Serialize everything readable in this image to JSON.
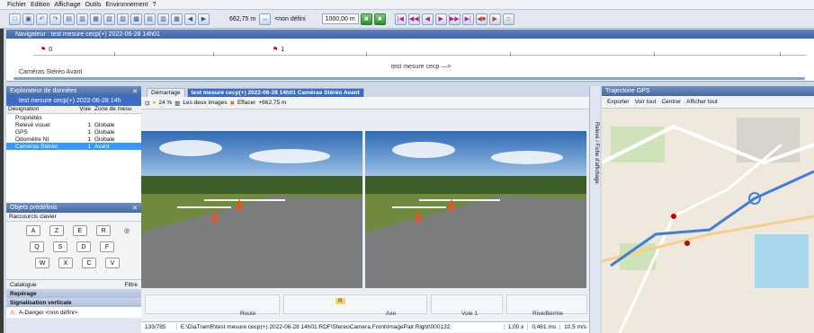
{
  "menu": [
    "Fichier",
    "Edition",
    "Affichage",
    "Outils",
    "Environnement",
    "?"
  ],
  "toolbar": {
    "distance_value": "662,75 m",
    "undefined_label": "<non défini",
    "zoom_value": "1000,00 m"
  },
  "navigator": {
    "title": "Navigateur : test mesure cecp(+) 2022-06-28 14h01",
    "marker0": "0",
    "marker1": "1",
    "track_label": "Caméras Stéréo Avant",
    "direction_label": "test mesure cecp —>"
  },
  "explorer": {
    "title": "Explorateur de données",
    "root": "test mesure cecp(+) 2022-06-28 14h",
    "columns": [
      "Désignation",
      "Voie",
      "Zone de mesu"
    ],
    "rows": [
      {
        "name": "Propriétés",
        "voie": "",
        "zone": ""
      },
      {
        "name": "Relevé visuel",
        "voie": "1",
        "zone": "Globale"
      },
      {
        "name": "GPS",
        "voie": "1",
        "zone": "Globale"
      },
      {
        "name": "Odomètre NI",
        "voie": "1",
        "zone": "Globale"
      },
      {
        "name": "Caméras Stéréo",
        "voie": "1",
        "zone": "Avant"
      }
    ]
  },
  "objects": {
    "title": "Objets prédéfinis",
    "shortcuts": "Raccourcis clavier",
    "keys_row1": [
      "A",
      "Z",
      "E",
      "R"
    ],
    "keys_row2": [
      "Q",
      "S",
      "D",
      "F"
    ],
    "keys_row3": [
      "W",
      "X",
      "C",
      "V"
    ],
    "catalogue": "Catalogue",
    "filter": "Filtre",
    "section1": "Repérage",
    "section2": "Signalisation verticale",
    "item1": "A-Danger <non défini>"
  },
  "viewer": {
    "tab1": "Démarrage",
    "tab2": "test mesure cecp(+) 2022-06-28 14h01 Caméras Stéréo Avant",
    "zoom": "24 %",
    "images_option": "Les deux images",
    "erase": "Effacer",
    "position": "+662,75 m"
  },
  "info": {
    "badge": "R",
    "col_route": "Route",
    "col_axe": "Axe",
    "col_voie": "Voie 1",
    "col_rive": "Rive/Berme"
  },
  "status": {
    "frame": "133/785",
    "path": "E:\\DiaTramR\\test mesure cecp(+) 2022-06-28 14h01.RDF\\StereoCamera.Front\\ImagePair.Right\\000132",
    "speed_factor": "1,00 x",
    "time_ms": "0,461 ms",
    "speed": "10,5 m/s"
  },
  "side_label": "Relevé / Fiche d'affichage",
  "gps": {
    "title": "Trajectoire GPS",
    "export": "Exporter",
    "view_all": "Voir tout",
    "center": "Centrer",
    "show_all": "Afficher tout"
  },
  "colors": {
    "accent": "#3b6cc7",
    "route": "#3f7fd6"
  }
}
